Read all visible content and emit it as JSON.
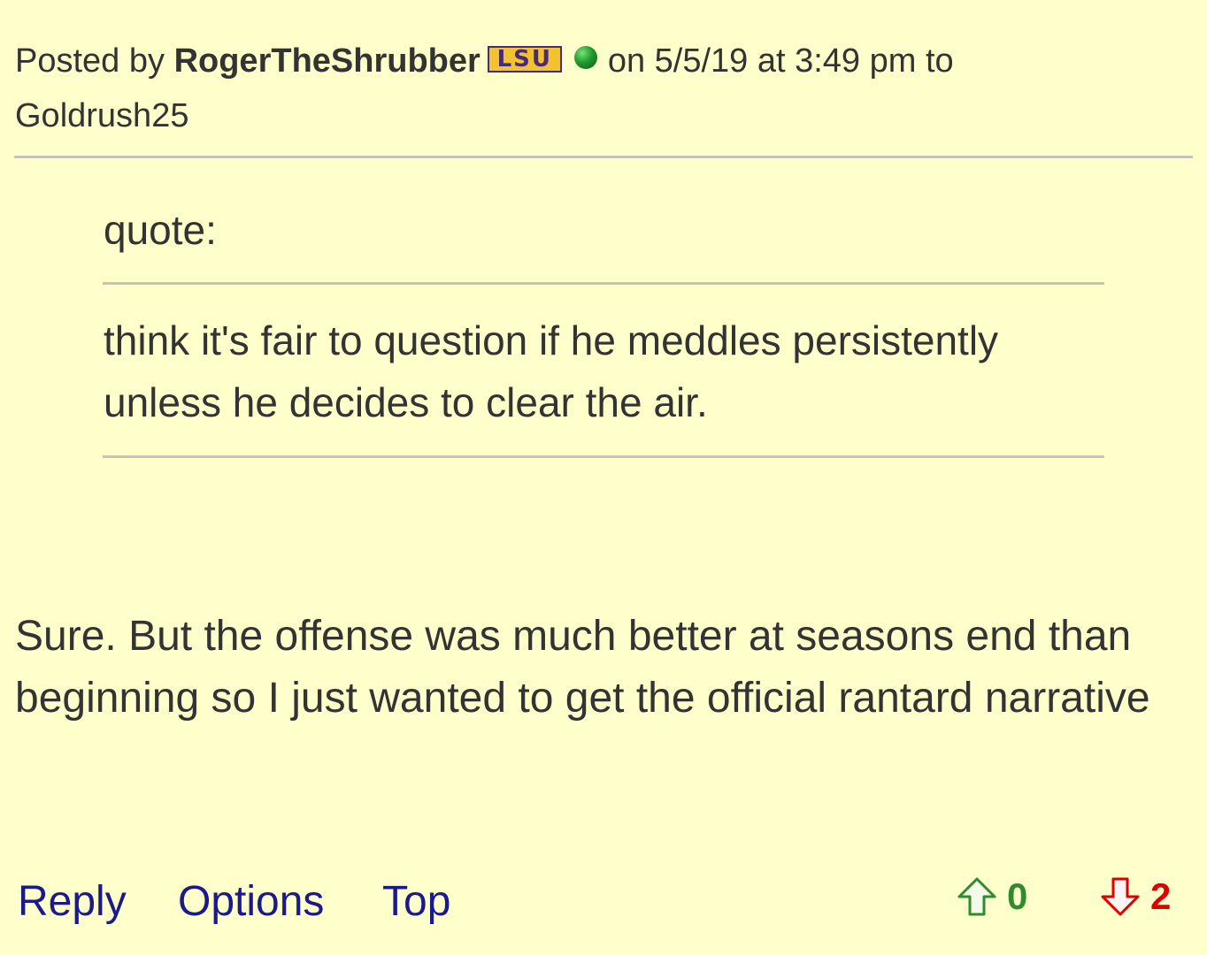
{
  "post": {
    "posted_by_label": "Posted by",
    "author": "RogerTheShrubber",
    "team_badge": "LSU",
    "date_text": "on 5/5/19 at 3:49 pm to",
    "recipient": "Goldrush25"
  },
  "quote": {
    "label": "quote:",
    "text": "think it's fair to question if he meddles persistently unless he decides to clear the air."
  },
  "body": {
    "text": "Sure. But the offense was much better at seasons end than beginning so I just wanted to get the official rantard narrative"
  },
  "actions": {
    "reply": "Reply",
    "options": "Options",
    "top": "Top"
  },
  "votes": {
    "up_count": "0",
    "down_count": "2"
  },
  "colors": {
    "background": "#ffffcc",
    "text": "#333333",
    "link": "#1a1a8c",
    "upvote": "#2e8b2e",
    "downvote": "#e00000",
    "badge_gold": "#f2c230",
    "badge_purple": "#4b2a78",
    "online": "#1f9a2a"
  },
  "icons": {
    "online": "online-status-icon",
    "upvote": "upvote-arrow-icon",
    "downvote": "downvote-arrow-icon"
  }
}
